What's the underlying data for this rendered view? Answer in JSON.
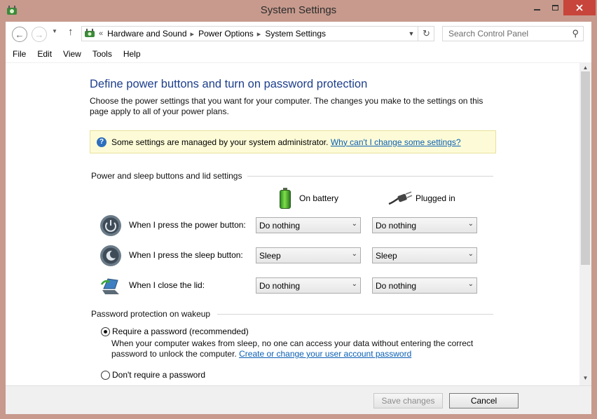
{
  "window": {
    "title": "System Settings"
  },
  "address": {
    "overflow": "«",
    "crumbs": [
      "Hardware and Sound",
      "Power Options",
      "System Settings"
    ],
    "search_placeholder": "Search Control Panel"
  },
  "menu": [
    "File",
    "Edit",
    "View",
    "Tools",
    "Help"
  ],
  "page": {
    "heading": "Define power buttons and turn on password protection",
    "description": "Choose the power settings that you want for your computer. The changes you make to the settings on this page apply to all of your power plans.",
    "info_text": "Some settings are managed by your system administrator.",
    "info_link": "Why can't I change some settings?"
  },
  "buttons_section": {
    "title": "Power and sleep buttons and lid settings",
    "col_battery": "On battery",
    "col_plugged": "Plugged in",
    "rows": [
      {
        "label": "When I press the power button:",
        "battery": "Do nothing",
        "plugged": "Do nothing"
      },
      {
        "label": "When I press the sleep button:",
        "battery": "Sleep",
        "plugged": "Sleep"
      },
      {
        "label": "When I close the lid:",
        "battery": "Do nothing",
        "plugged": "Do nothing"
      }
    ]
  },
  "password_section": {
    "title": "Password protection on wakeup",
    "require_label": "Require a password (recommended)",
    "require_desc": "When your computer wakes from sleep, no one can access your data without entering the correct password to unlock the computer.",
    "require_link": "Create or change your user account password",
    "dont_require_label": "Don't require a password",
    "selected": "require"
  },
  "footer": {
    "save_label": "Save changes",
    "cancel_label": "Cancel"
  },
  "colors": {
    "heading": "#1e3f8c",
    "link": "#0a5fb4",
    "frame": "#c79a8d",
    "close_button": "#c7453a",
    "info_background": "#fdfbd7"
  }
}
